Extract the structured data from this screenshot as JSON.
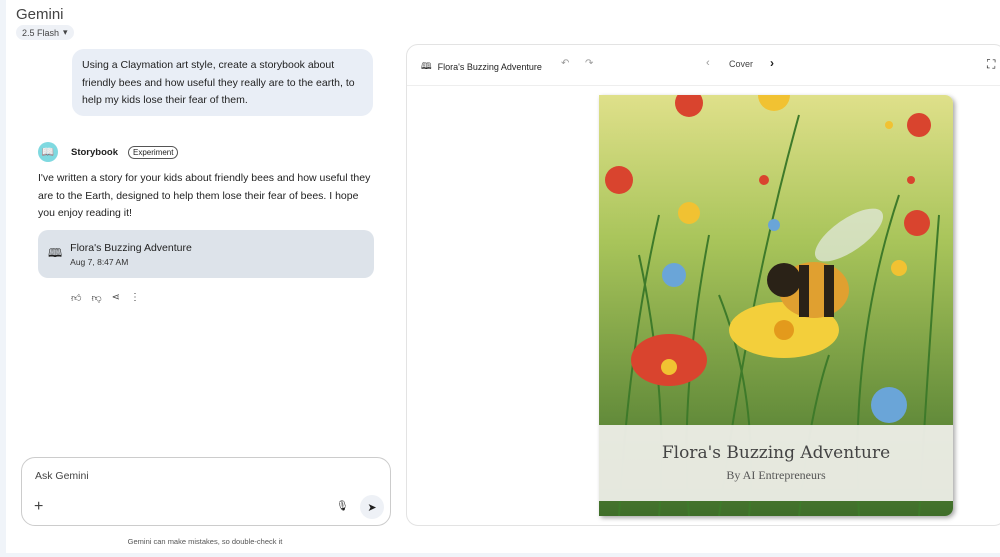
{
  "app": {
    "title": "Gemini",
    "model": "2.5 Flash"
  },
  "chat": {
    "user_message": "Using a Claymation art style, create a storybook about friendly bees and how useful they really are to the earth, to help my kids lose their fear of them.",
    "assistant_name": "Storybook",
    "assistant_badge": "Experiment",
    "reply": "I've written a story for your kids about friendly bees and how useful they are to the Earth, designed to help them lose their fear of bees. I hope you enjoy reading it!",
    "card": {
      "title": "Flora's Buzzing Adventure",
      "date": "Aug 7, 8:47 AM"
    }
  },
  "input": {
    "placeholder": "Ask Gemini",
    "disclaimer": "Gemini can make mistakes, so double-check it"
  },
  "panel": {
    "title": "Flora's Buzzing Adventure",
    "page": "Cover"
  },
  "book": {
    "title": "Flora's Buzzing Adventure",
    "author": "By AI Entrepreneurs"
  }
}
